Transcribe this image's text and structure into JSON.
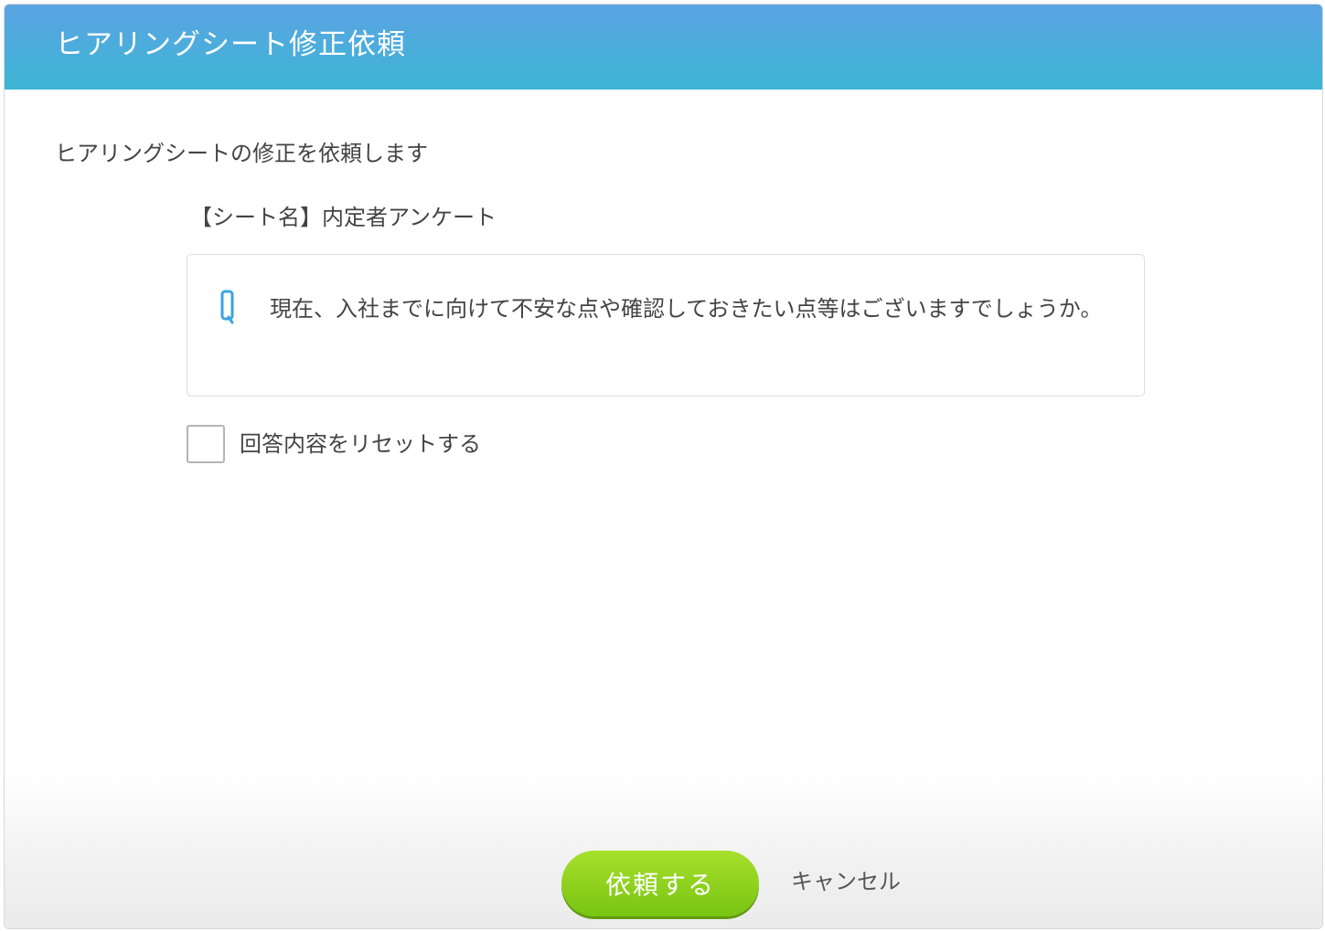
{
  "header": {
    "title": "ヒアリングシート修正依頼"
  },
  "body": {
    "intro": "ヒアリングシートの修正を依頼します",
    "sheet_name": "【シート名】内定者アンケート",
    "question": {
      "icon": "q-icon",
      "text": "現在、入社までに向けて不安な点や確認しておきたい点等はございますでしょうか。"
    },
    "reset_checkbox": {
      "label": "回答内容をリセットする",
      "checked": false
    }
  },
  "footer": {
    "submit_label": "依頼する",
    "cancel_label": "キャンセル"
  },
  "colors": {
    "header_top": "#5ba3e3",
    "header_bottom": "#3db6d4",
    "accent_icon": "#3aa3e0",
    "submit_top": "#a6e02c",
    "submit_bottom": "#79c412"
  }
}
